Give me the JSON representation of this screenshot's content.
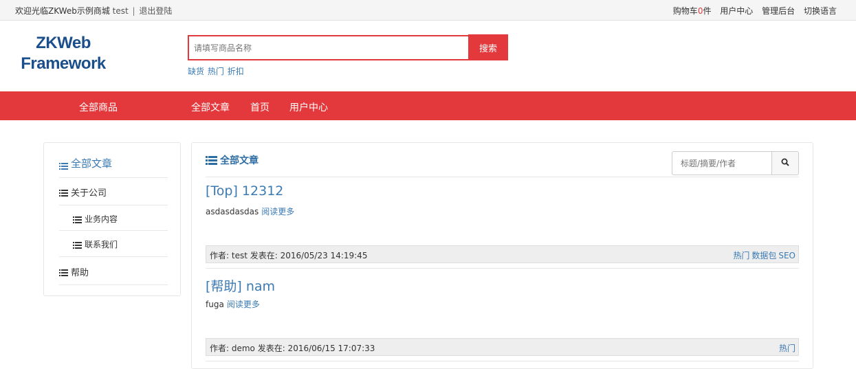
{
  "topbar": {
    "welcome": "欢迎光临ZKWeb示例商城",
    "username": "test",
    "separator": "|",
    "logout": "退出登陆",
    "cart_label": "购物车",
    "cart_count": "0",
    "cart_unit": "件",
    "user_center": "用户中心",
    "admin": "管理后台",
    "language": "切换语言"
  },
  "header": {
    "logo_line1": "ZKWeb",
    "logo_line2": "Framework",
    "search_placeholder": "请填写商品名称",
    "search_button": "搜索",
    "hot_keywords": [
      "缺货",
      "热门",
      "折扣"
    ]
  },
  "nav": {
    "all_products": "全部商品",
    "items": [
      "全部文章",
      "首页",
      "用户中心"
    ]
  },
  "sidebar": {
    "items": [
      {
        "label": "全部文章",
        "level": 0,
        "active": true
      },
      {
        "label": "关于公司",
        "level": 0,
        "active": false
      },
      {
        "label": "业务内容",
        "level": 1,
        "active": false
      },
      {
        "label": "联系我们",
        "level": 1,
        "active": false
      },
      {
        "label": "帮助",
        "level": 0,
        "active": false
      }
    ]
  },
  "main": {
    "title": "全部文章",
    "search_placeholder": "标题/摘要/作者",
    "read_more": "阅读更多",
    "articles": [
      {
        "title": "[Top] 12312",
        "summary": "asdasdasdas",
        "meta": "作者: test 发表在: 2016/05/23 14:19:45",
        "tags": [
          "热门",
          "数据包",
          "SEO"
        ]
      },
      {
        "title": "[帮助] nam",
        "summary": "fuga",
        "meta": "作者: demo 发表在: 2016/06/15 17:07:33",
        "tags": [
          "热门"
        ]
      }
    ]
  },
  "colors": {
    "brand_red": "#e4393c",
    "link_blue": "#3a7ab3",
    "logo_blue": "#1a4f8b"
  }
}
